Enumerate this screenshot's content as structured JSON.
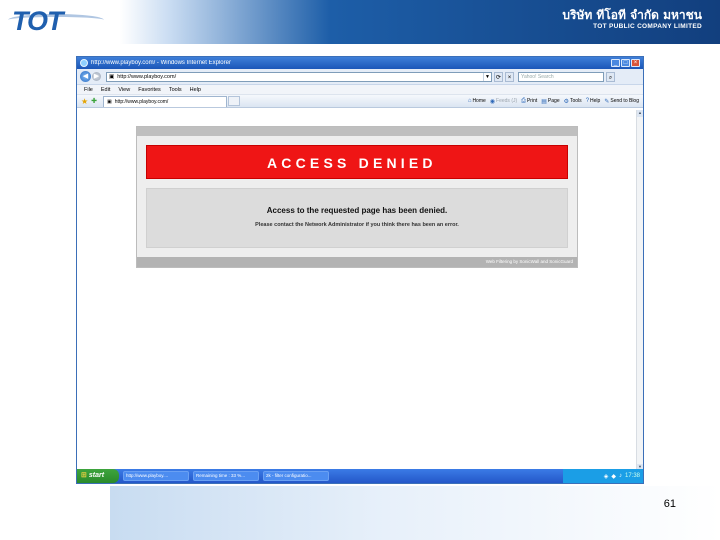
{
  "slide": {
    "logo_text": "TOT",
    "company_thai": "บริษัท ทีโอที จำกัด มหาชน",
    "company_english": "TOT PUBLIC COMPANY LIMITED",
    "page_number": "61"
  },
  "browser": {
    "window_title": "http://www.playboy.com/ - Windows Internet Explorer",
    "address": "http://www.playboy.com/",
    "search_placeholder": "Yahoo! Search",
    "menu": [
      "File",
      "Edit",
      "View",
      "Favorites",
      "Tools",
      "Help"
    ],
    "tab_title": "http://www.playboy.com/",
    "commands": [
      {
        "label": "Home",
        "icon": "home-icon",
        "enabled": true
      },
      {
        "label": "Feeds (J)",
        "icon": "feeds-icon",
        "enabled": false
      },
      {
        "label": "Print",
        "icon": "print-icon",
        "enabled": true
      },
      {
        "label": "Page",
        "icon": "page-icon",
        "enabled": true
      },
      {
        "label": "Tools",
        "icon": "tools-icon",
        "enabled": true
      },
      {
        "label": "Help",
        "icon": "help-icon",
        "enabled": true
      },
      {
        "label": "Send to Blog",
        "icon": "blog-icon",
        "enabled": true
      }
    ]
  },
  "denied_page": {
    "banner": "ACCESS DENIED",
    "message": "Access to the requested page has been denied.",
    "submessage": "Please contact the Network Administrator if you think there has been an error.",
    "footer": "Web Filtering by SonicWall and SonicGuard",
    "banner_color": "#ef1515"
  },
  "taskbar": {
    "start_label": "start",
    "tasks": [
      "http://www.playboy....",
      "Remaining time : 33 %...",
      "2k - filter configuratio..."
    ],
    "clock": "17:38"
  }
}
